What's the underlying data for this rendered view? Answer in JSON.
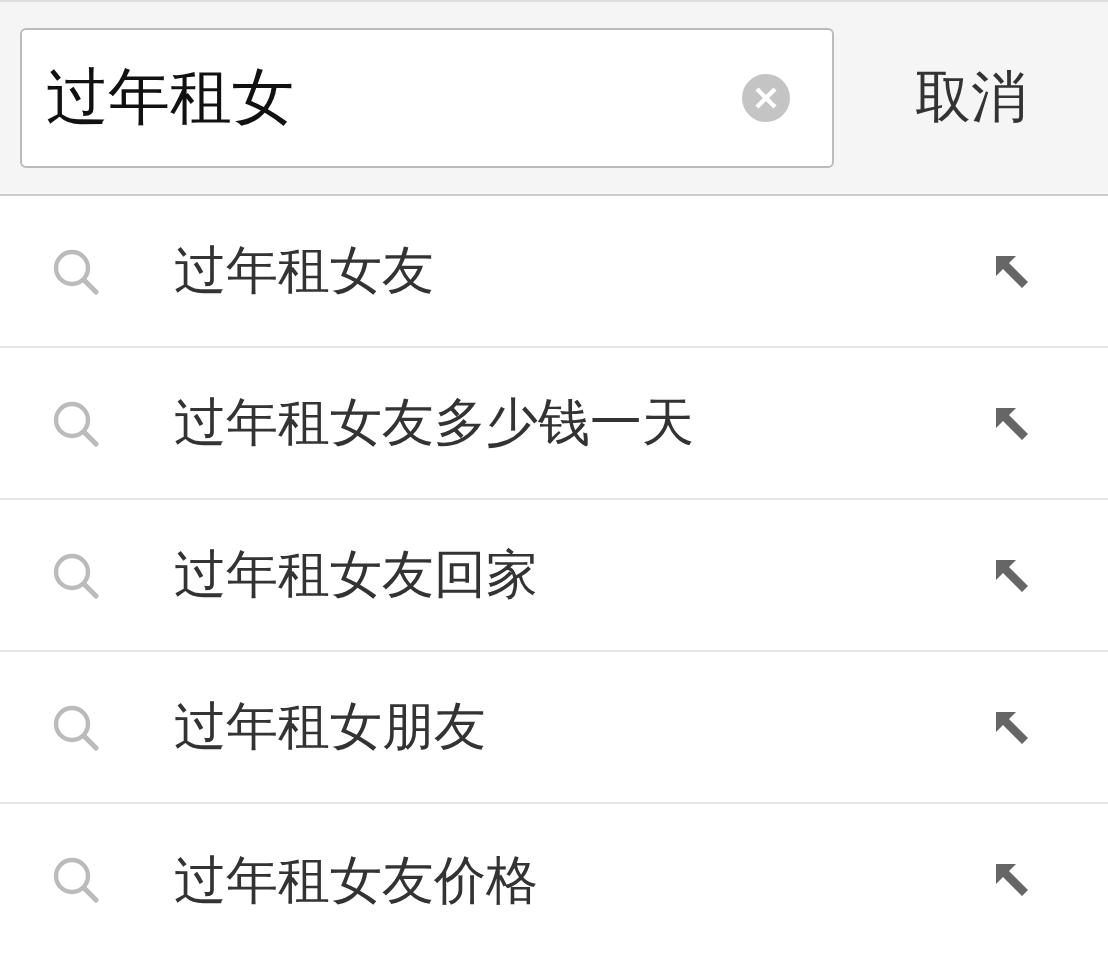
{
  "search": {
    "value": "过年租女",
    "cancel": "取消"
  },
  "suggestions": [
    {
      "text": "过年租女友"
    },
    {
      "text": "过年租女友多少钱一天"
    },
    {
      "text": "过年租女友回家"
    },
    {
      "text": "过年租女朋友"
    },
    {
      "text": "过年租女友价格"
    }
  ]
}
